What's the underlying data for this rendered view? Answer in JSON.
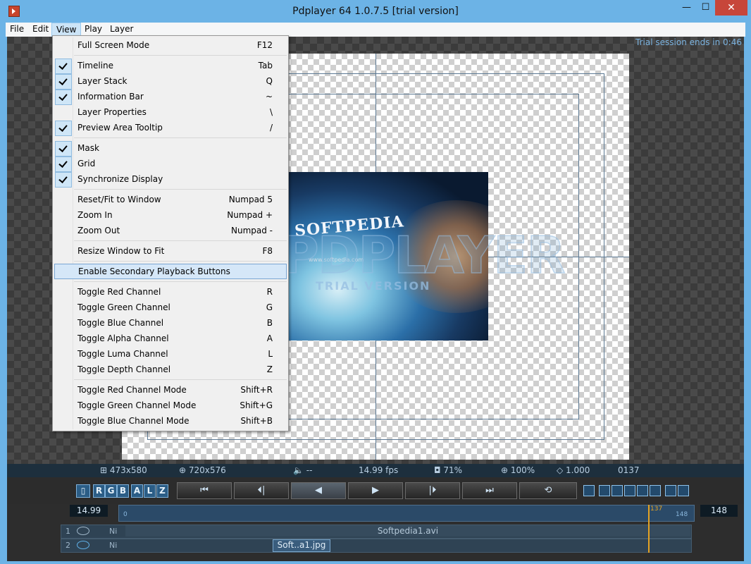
{
  "window": {
    "title": "Pdplayer 64 1.0.7.5 [trial version]",
    "min": "—",
    "max": "☐",
    "close": "✕"
  },
  "menubar": [
    "File",
    "Edit",
    "View",
    "Play",
    "Layer"
  ],
  "menubar_watermark": "www.softpedia.com",
  "view_menu": [
    {
      "label": "Full Screen Mode",
      "shortcut": "F12",
      "checked": false
    },
    {
      "label": "Timeline",
      "shortcut": "Tab",
      "checked": true
    },
    {
      "label": "Layer Stack",
      "shortcut": "Q",
      "checked": true
    },
    {
      "label": "Information Bar",
      "shortcut": "~",
      "checked": true
    },
    {
      "label": "Layer Properties",
      "shortcut": "\\",
      "checked": false
    },
    {
      "label": "Preview Area Tooltip",
      "shortcut": "/",
      "checked": true
    },
    {
      "label": "Mask",
      "shortcut": "",
      "checked": true
    },
    {
      "label": "Grid",
      "shortcut": "",
      "checked": true
    },
    {
      "label": "Synchronize Display",
      "shortcut": "",
      "checked": true
    },
    {
      "label": "Reset/Fit to Window",
      "shortcut": "Numpad 5",
      "checked": false
    },
    {
      "label": "Zoom In",
      "shortcut": "Numpad +",
      "checked": false
    },
    {
      "label": "Zoom Out",
      "shortcut": "Numpad -",
      "checked": false
    },
    {
      "label": "Resize Window to Fit",
      "shortcut": "F8",
      "checked": false
    },
    {
      "label": "Enable Secondary Playback Buttons",
      "shortcut": "",
      "checked": false,
      "highlighted": true
    },
    {
      "label": "Toggle Red Channel",
      "shortcut": "R",
      "checked": false
    },
    {
      "label": "Toggle Green Channel",
      "shortcut": "G",
      "checked": false
    },
    {
      "label": "Toggle Blue Channel",
      "shortcut": "B",
      "checked": false
    },
    {
      "label": "Toggle Alpha Channel",
      "shortcut": "A",
      "checked": false
    },
    {
      "label": "Toggle Luma Channel",
      "shortcut": "L",
      "checked": false
    },
    {
      "label": "Toggle Depth Channel",
      "shortcut": "Z",
      "checked": false
    },
    {
      "label": "Toggle Red Channel Mode",
      "shortcut": "Shift+R",
      "checked": false
    },
    {
      "label": "Toggle Green Channel Mode",
      "shortcut": "Shift+G",
      "checked": false
    },
    {
      "label": "Toggle Blue Channel Mode",
      "shortcut": "Shift+B",
      "checked": false
    }
  ],
  "trial_note": "Trial session ends in 0:46",
  "video": {
    "logo": "SOFTPEDIA",
    "subtitle": "www.softpedia.com",
    "watermark": "PDPLAYER",
    "watermark_sub": "TRIAL VERSION"
  },
  "infobar": {
    "size": "473x580",
    "canvas": "720x576",
    "audio": "--",
    "fps": "14.99 fps",
    "opacity": "71%",
    "zoom": "100%",
    "ratio": "1.000",
    "frame": "0137"
  },
  "channels": [
    "RGB",
    "A",
    "L",
    "Z"
  ],
  "channel_letters": {
    "r": "R",
    "g": "G",
    "b": "B",
    "a": "A",
    "l": "L",
    "z": "Z"
  },
  "playback": {
    "first": "⏮",
    "prev": "⏴|",
    "reverse": "◀",
    "play": "▶",
    "next": "|⏵",
    "last": "⏭",
    "loop": "⟲"
  },
  "timeline": {
    "fps": "14.99",
    "start": "0",
    "current": "137",
    "end_mark": "148",
    "end": "148"
  },
  "layers": [
    {
      "index": "1",
      "flag": "Ni",
      "name": "Softpedia1.avi"
    },
    {
      "index": "2",
      "flag": "Ni",
      "name": "Soft..a1.jpg"
    }
  ],
  "colors": {
    "title_bg": "#6cb3e6",
    "accent": "#2b5d86",
    "playhead": "#e5a323",
    "close": "#c7463a"
  }
}
